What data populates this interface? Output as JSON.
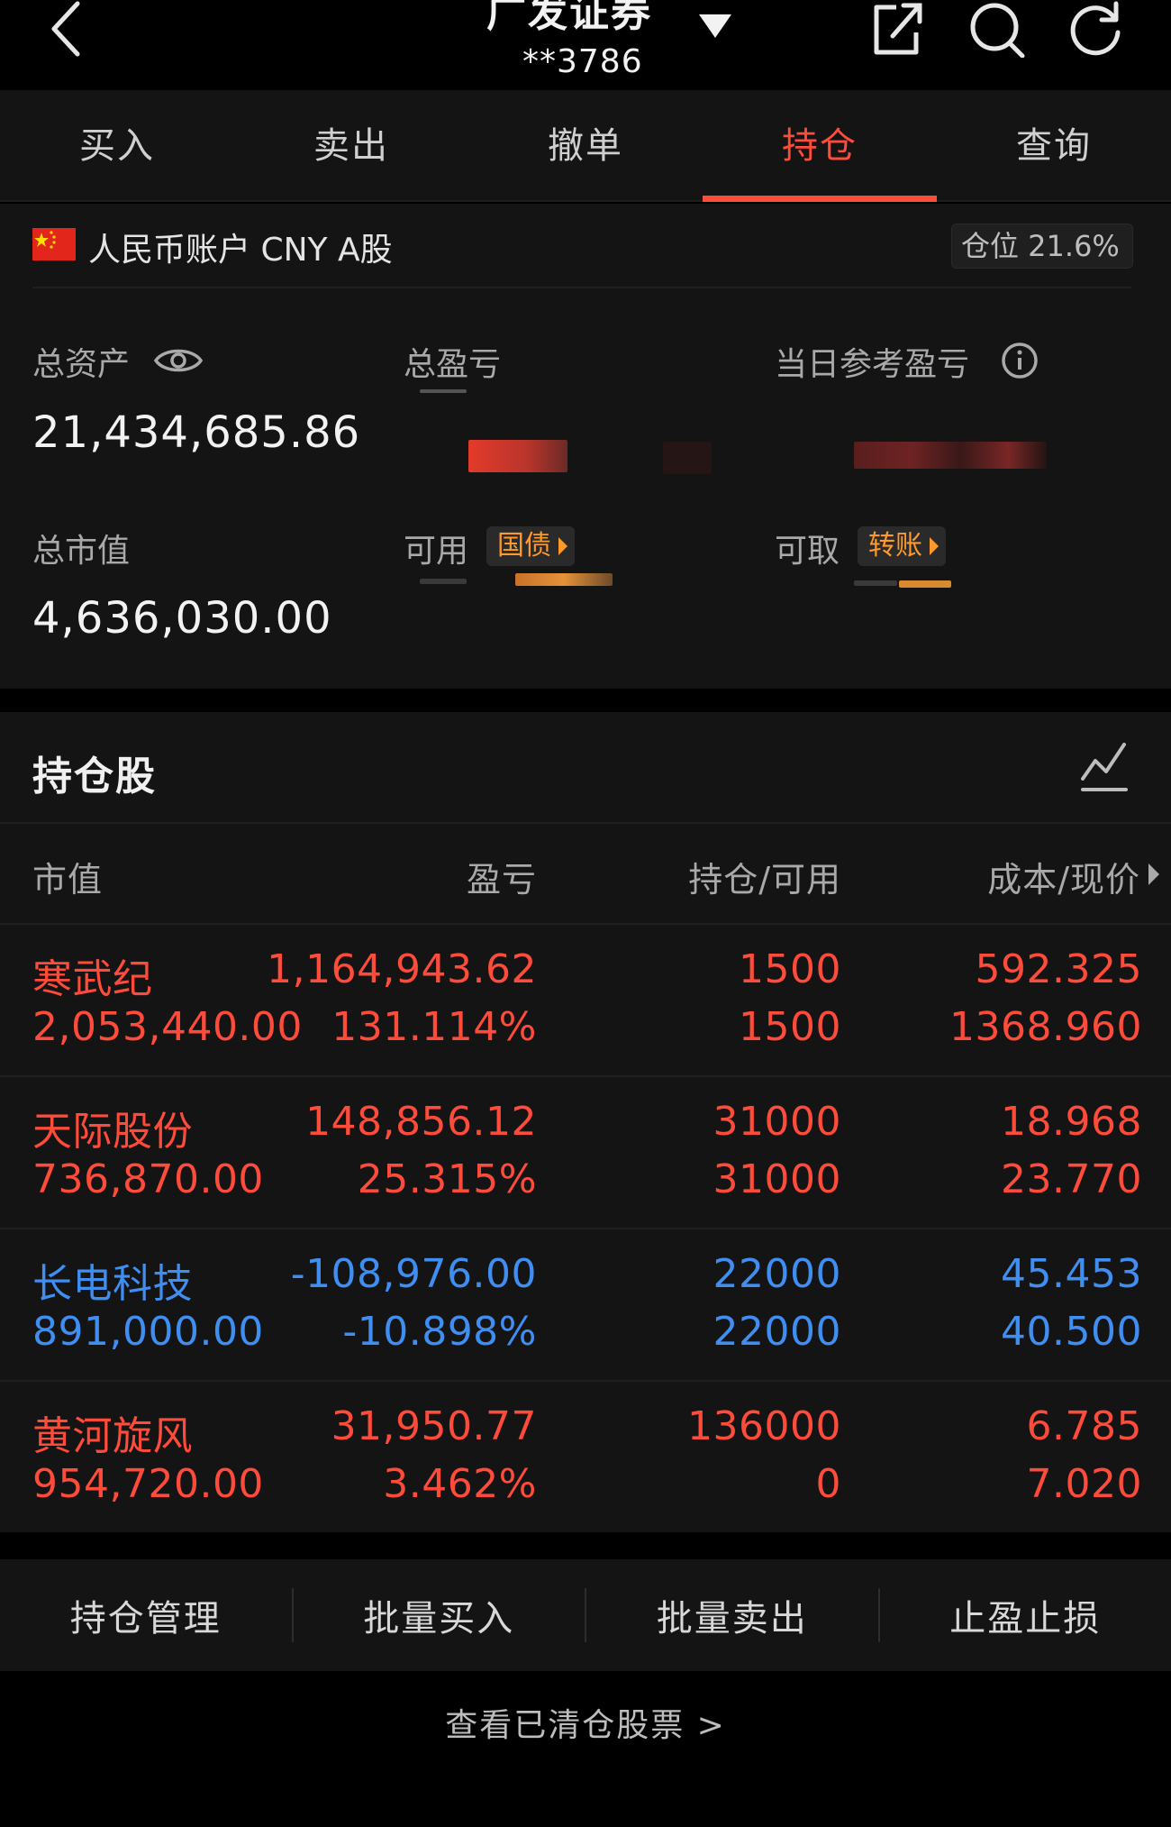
{
  "header": {
    "broker_name": "广发证券",
    "account_masked": "**3786"
  },
  "tabs": [
    {
      "label": "买入"
    },
    {
      "label": "卖出"
    },
    {
      "label": "撤单"
    },
    {
      "label": "持仓",
      "active": true
    },
    {
      "label": "查询"
    }
  ],
  "account": {
    "label": "人民币账户 CNY A股",
    "position_badge": "仓位 21.6%"
  },
  "summary": {
    "total_assets_label": "总资产",
    "total_assets_value": "21,434,685.86",
    "total_pnl_label": "总盈亏",
    "daily_pnl_label": "当日参考盈亏",
    "market_value_label": "总市值",
    "market_value_value": "4,636,030.00",
    "available_label": "可用",
    "available_tag": "国债",
    "withdrawable_label": "可取",
    "withdrawable_tag": "转账"
  },
  "holdings": {
    "title": "持仓股",
    "columns": [
      "市值",
      "盈亏",
      "持仓/可用",
      "成本/现价"
    ],
    "rows": [
      {
        "name": "寒武纪",
        "market_value": "2,053,440.00",
        "pnl": "1,164,943.62",
        "pnl_pct": "131.114%",
        "position": "1500",
        "available": "1500",
        "cost": "592.325",
        "price": "1368.960",
        "color": "red"
      },
      {
        "name": "天际股份",
        "market_value": "736,870.00",
        "pnl": "148,856.12",
        "pnl_pct": "25.315%",
        "position": "31000",
        "available": "31000",
        "cost": "18.968",
        "price": "23.770",
        "color": "red"
      },
      {
        "name": "长电科技",
        "market_value": "891,000.00",
        "pnl": "-108,976.00",
        "pnl_pct": "-10.898%",
        "position": "22000",
        "available": "22000",
        "cost": "45.453",
        "price": "40.500",
        "color": "blue"
      },
      {
        "name": "黄河旋风",
        "market_value": "954,720.00",
        "pnl": "31,950.77",
        "pnl_pct": "3.462%",
        "position": "136000",
        "available": "0",
        "cost": "6.785",
        "price": "7.020",
        "color": "red"
      }
    ]
  },
  "actions": [
    {
      "label": "持仓管理"
    },
    {
      "label": "批量买入"
    },
    {
      "label": "批量卖出"
    },
    {
      "label": "止盈止损"
    }
  ],
  "footer": {
    "cleared_link": "查看已清仓股票 >"
  },
  "colors": {
    "up": "#ff4b3a",
    "down": "#3f8ef2",
    "accent_tag": "#ff9a2a"
  }
}
